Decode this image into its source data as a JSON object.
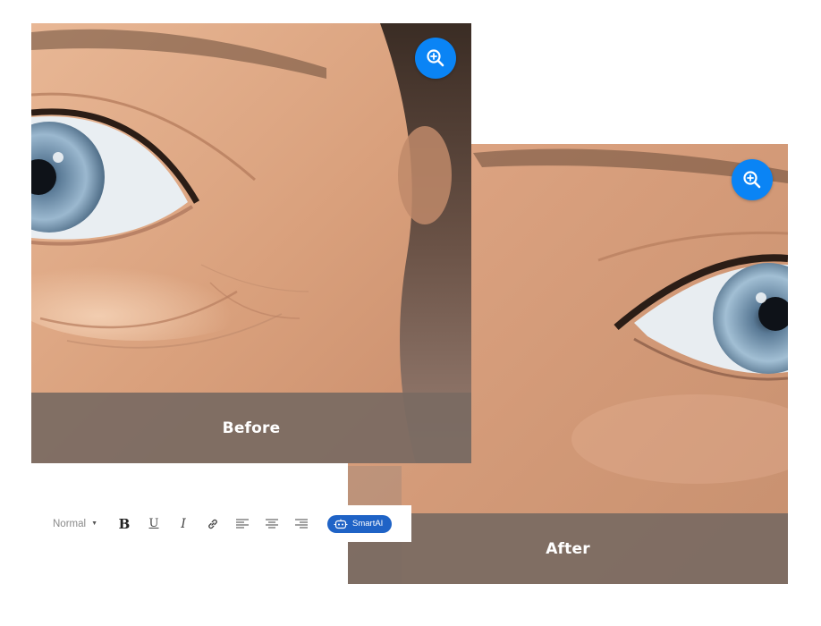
{
  "comparison": {
    "before": {
      "caption": "Before",
      "zoom_icon": "zoom-in-icon"
    },
    "after": {
      "caption": "After",
      "zoom_icon": "zoom-in-icon"
    }
  },
  "colors": {
    "accent_blue": "#0a84f5",
    "caption_bar": "#7a6a62",
    "smartai_blue": "#1f63c6"
  },
  "toolbar": {
    "format_value": "Normal",
    "buttons": [
      {
        "name": "bold",
        "glyph": "B"
      },
      {
        "name": "underline",
        "glyph": "U"
      },
      {
        "name": "italic",
        "glyph": "I"
      },
      {
        "name": "link",
        "icon": "link-icon"
      },
      {
        "name": "align-left",
        "icon": "align-left-icon"
      },
      {
        "name": "align-center",
        "icon": "align-center-icon"
      },
      {
        "name": "align-right",
        "icon": "align-right-icon"
      }
    ],
    "smartai_label": "SmartAI",
    "smartai_icon": "robot-icon"
  }
}
